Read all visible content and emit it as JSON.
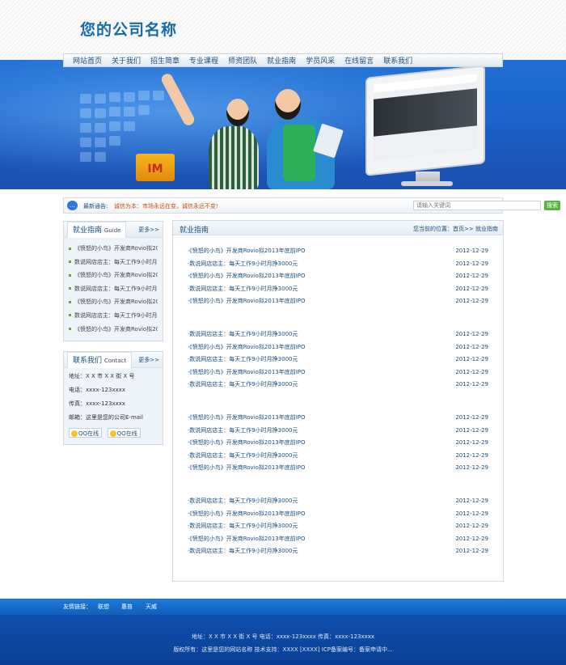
{
  "header": {
    "logo_text": "您的公司名称"
  },
  "nav": [
    "网站首页",
    "关于我们",
    "招生简章",
    "专业课程",
    "师资团队",
    "就业指南",
    "学员风采",
    "在线留言",
    "联系我们"
  ],
  "banner": {
    "box_text": "IM"
  },
  "notice": {
    "label": "最新通告:",
    "message": "诚信为本：市场永远在变，诚信永远不变!",
    "search_placeholder": "请输入关键词",
    "search_button": "搜索"
  },
  "sidebar_guide": {
    "title": "就业指南",
    "title_en": "Guide",
    "more": "更多>>",
    "items": [
      "《愤怒的小鸟》开发商Rovio拟20…",
      "数说网店店主：每天工作9小时月…",
      "《愤怒的小鸟》开发商Rovio拟20…",
      "数说网店店主：每天工作9小时月…",
      "《愤怒的小鸟》开发商Rovio拟20…",
      "数说网店店主：每天工作9小时月…",
      "《愤怒的小鸟》开发商Rovio拟20…"
    ]
  },
  "sidebar_contact": {
    "title": "联系我们",
    "title_en": "Contact",
    "more": "更多>>",
    "address": "地址：X X 市 X X 街 X 号",
    "phone": "电话：xxxx-123xxxx",
    "fax": "传真：xxxx-123xxxx",
    "email": "邮箱：这里是您的公司E-mail",
    "qq_buttons": [
      "QQ在线",
      "QQ在线"
    ]
  },
  "main": {
    "title": "就业指南",
    "breadcrumb": "您当前的位置：首页>> 就业指南",
    "groups": [
      [
        {
          "title": "·《愤怒的小鸟》开发商Rovio拟2013年底前IPO",
          "date": "2012-12-29"
        },
        {
          "title": "·数说网店店主：每天工作9小时月挣3000元",
          "date": "2012-12-29"
        },
        {
          "title": "·《愤怒的小鸟》开发商Rovio拟2013年底前IPO",
          "date": "2012-12-29"
        },
        {
          "title": "·数说网店店主：每天工作9小时月挣3000元",
          "date": "2012-12-29"
        },
        {
          "title": "·《愤怒的小鸟》开发商Rovio拟2013年底前IPO",
          "date": "2012-12-29"
        }
      ],
      [
        {
          "title": "·数说网店店主：每天工作9小时月挣3000元",
          "date": "2012-12-29"
        },
        {
          "title": "·《愤怒的小鸟》开发商Rovio拟2013年底前IPO",
          "date": "2012-12-29"
        },
        {
          "title": "·数说网店店主：每天工作9小时月挣3000元",
          "date": "2012-12-29"
        },
        {
          "title": "·《愤怒的小鸟》开发商Rovio拟2013年底前IPO",
          "date": "2012-12-29"
        },
        {
          "title": "·数说网店店主：每天工作9小时月挣3000元",
          "date": "2012-12-29"
        }
      ],
      [
        {
          "title": "·《愤怒的小鸟》开发商Rovio拟2013年底前IPO",
          "date": "2012-12-29"
        },
        {
          "title": "·数说网店店主：每天工作9小时月挣3000元",
          "date": "2012-12-29"
        },
        {
          "title": "·《愤怒的小鸟》开发商Rovio拟2013年底前IPO",
          "date": "2012-12-29"
        },
        {
          "title": "·数说网店店主：每天工作9小时月挣3000元",
          "date": "2012-12-29"
        },
        {
          "title": "·《愤怒的小鸟》开发商Rovio拟2013年底前IPO",
          "date": "2012-12-29"
        }
      ],
      [
        {
          "title": "·数说网店店主：每天工作9小时月挣3000元",
          "date": "2012-12-29"
        },
        {
          "title": "·《愤怒的小鸟》开发商Rovio拟2013年底前IPO",
          "date": "2012-12-29"
        },
        {
          "title": "·数说网店店主：每天工作9小时月挣3000元",
          "date": "2012-12-29"
        },
        {
          "title": "·《愤怒的小鸟》开发商Rovio拟2013年底前IPO",
          "date": "2012-12-29"
        },
        {
          "title": "·数说网店店主：每天工作9小时月挣3000元",
          "date": "2012-12-29"
        }
      ]
    ]
  },
  "friends": {
    "label": "友情链接：",
    "links": [
      "联想",
      "惠普",
      "天威"
    ]
  },
  "footer": {
    "line1": "地址：X X 市 X X 街 X 号 电话：xxxx-123xxxx 传真：xxxx-123xxxx",
    "line2": "版权所有：这里是您的网站名称 技术支持：XXXX [XXXX] ICP备案编号：备案申请中..."
  },
  "colors": {
    "brand_blue": "#1869a8",
    "nav_text": "#1b4e7e",
    "notice_accent": "#d04a12",
    "search_green": "#58b43c",
    "footer_blue": "#0a3f93"
  }
}
